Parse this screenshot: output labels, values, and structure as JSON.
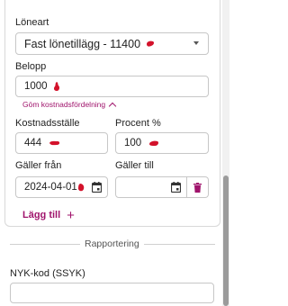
{
  "form": {
    "loneart_label": "Löneart",
    "loneart_value": "Fast lönetillägg - 11400",
    "belopp_label": "Belopp",
    "belopp_value": "1000",
    "toggle_cost_label": "Göm kostnadsfördelning",
    "kostnadsstalle_label": "Kostnadsställe",
    "kostnadsstalle_value": "444",
    "procent_label": "Procent %",
    "procent_value": "100",
    "galler_fran_label": "Gäller från",
    "galler_fran_value": "2024-04-01",
    "galler_till_label": "Gäller till",
    "galler_till_value": "",
    "add_label": "Lägg till",
    "add_icon": "plus-icon"
  },
  "reporting": {
    "section_label": "Rapportering",
    "nyk_label": "NYK-kod (SSYK)",
    "nyk_value": ""
  },
  "icons": {
    "dropdown": "chevron-down-icon",
    "calendar": "calendar-icon",
    "delete": "trash-icon",
    "collapse": "chevron-up-icon"
  },
  "colors": {
    "accent": "#a0146c",
    "redaction": "#d3122b",
    "border": "#c7c7c7"
  }
}
